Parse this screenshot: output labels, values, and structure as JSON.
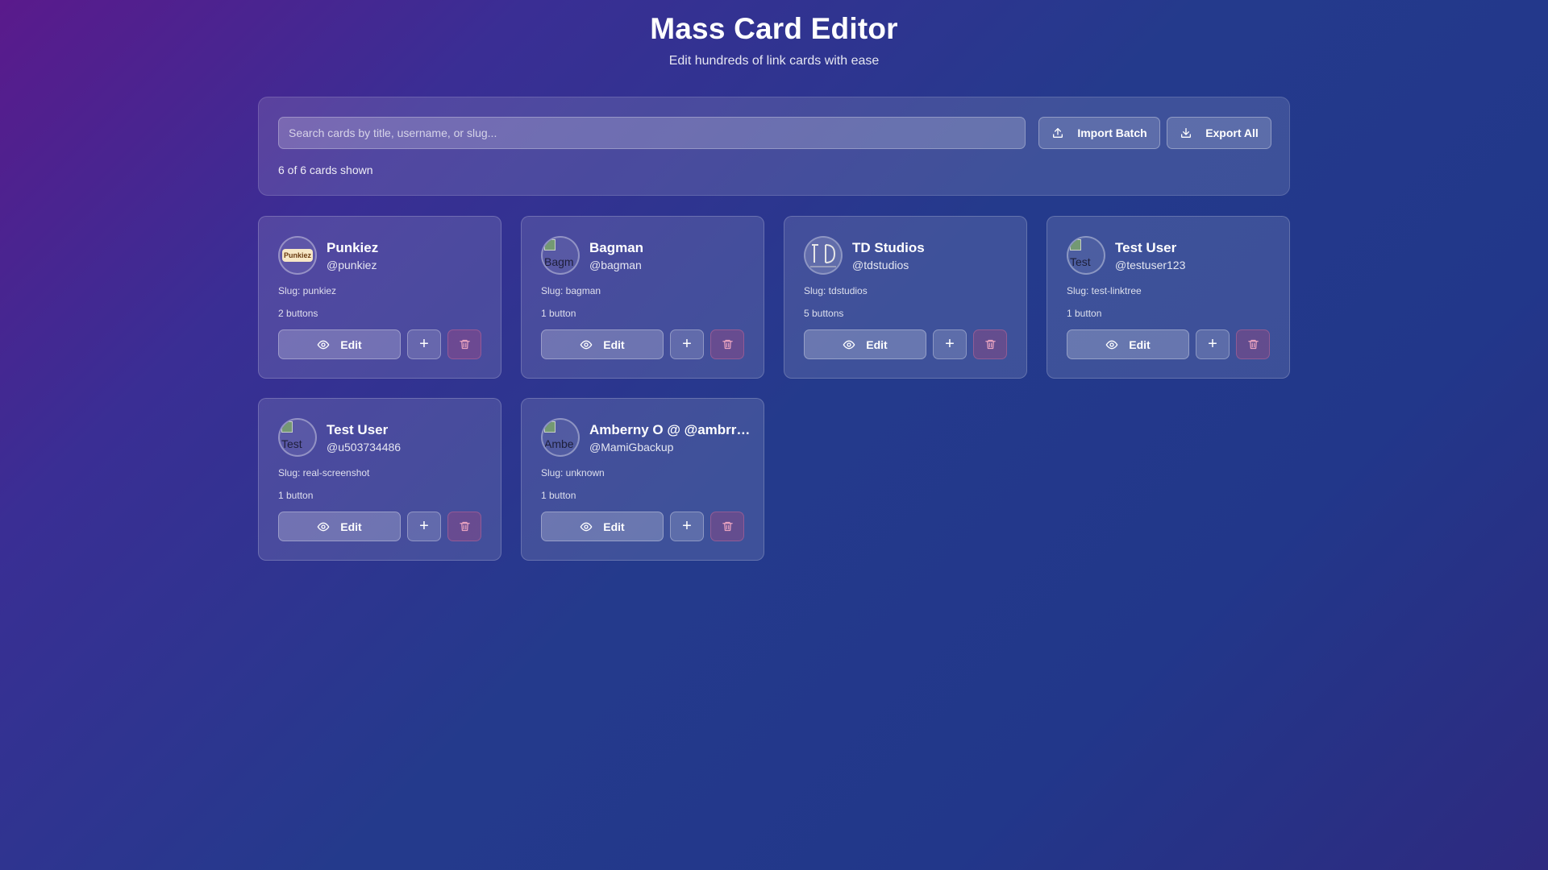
{
  "header": {
    "title": "Mass Card Editor",
    "subtitle": "Edit hundreds of link cards with ease"
  },
  "toolbar": {
    "search_placeholder": "Search cards by title, username, or slug...",
    "search_value": "",
    "import_label": "Import Batch",
    "export_label": "Export All",
    "count_text": "6 of 6 cards shown"
  },
  "card_labels": {
    "edit": "Edit",
    "add_icon": "plus-icon",
    "delete_icon": "trash-icon",
    "view_icon": "eye-icon"
  },
  "cards": [
    {
      "name": "Punkiez",
      "handle": "@punkiez",
      "slug": "Slug: punkiez",
      "buttons": "2 buttons",
      "avatar_alt": "",
      "avatar_type": "punkiez-logo",
      "avatar_logo_text": "Punkiez"
    },
    {
      "name": "Bagman",
      "handle": "@bagman",
      "slug": "Slug: bagman",
      "buttons": "1 button",
      "avatar_alt": "Bagm",
      "avatar_type": "broken-image"
    },
    {
      "name": "TD Studios",
      "handle": "@tdstudios",
      "slug": "Slug: tdstudios",
      "buttons": "5 buttons",
      "avatar_alt": "",
      "avatar_type": "td-logo"
    },
    {
      "name": "Test User",
      "handle": "@testuser123",
      "slug": "Slug: test-linktree",
      "buttons": "1 button",
      "avatar_alt": "Test",
      "avatar_type": "broken-image"
    },
    {
      "name": "Test User",
      "handle": "@u503734486",
      "slug": "Slug: real-screenshot",
      "buttons": "1 button",
      "avatar_alt": "Test",
      "avatar_type": "broken-image"
    },
    {
      "name": "Amberny O @ @ambrrr...",
      "handle": "@MamiGbackup",
      "slug": "Slug: unknown",
      "buttons": "1 button",
      "avatar_alt": "Ambe",
      "avatar_type": "broken-image"
    }
  ],
  "colors": {
    "bg_start": "#5a1a8c",
    "bg_end": "#22378a",
    "delete_tint": "#be4678"
  }
}
